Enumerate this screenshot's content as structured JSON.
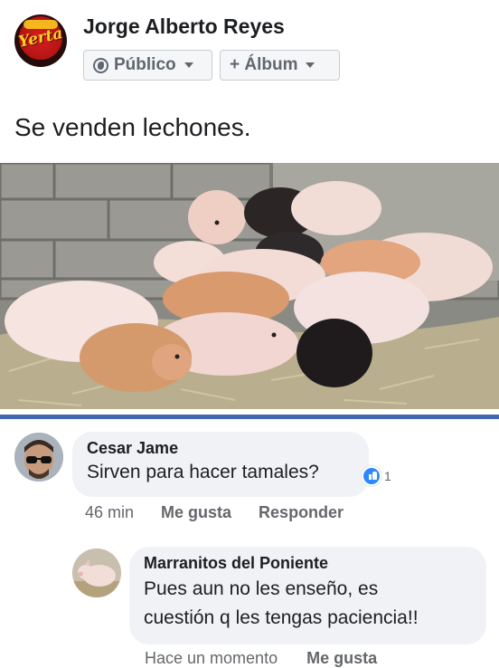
{
  "post": {
    "author": "Jorge Alberto Reyes",
    "avatar_logo_text": "Yerta",
    "audience_label": "Público",
    "album_label": "+ Álbum",
    "text": "Se venden lechones."
  },
  "photo": {
    "subject": "piglets-in-hay"
  },
  "colors": {
    "accent_blue": "#4267b2",
    "bubble_bg": "#f0f2f5",
    "meta_gray": "#65676b",
    "like_blue": "#2d88ff"
  },
  "comments": [
    {
      "author": "Cesar Jame",
      "text": "Sirven para hacer tamales?",
      "reaction_count": "1",
      "time": "46 min",
      "like_label": "Me gusta",
      "reply_label": "Responder"
    },
    {
      "author": "Marranitos del Poniente",
      "text_line1": "Pues aun no les enseño, es",
      "text_line2": "cuestión q les tengas paciencia!!",
      "time": "Hace un momento",
      "like_label": "Me gusta"
    }
  ]
}
